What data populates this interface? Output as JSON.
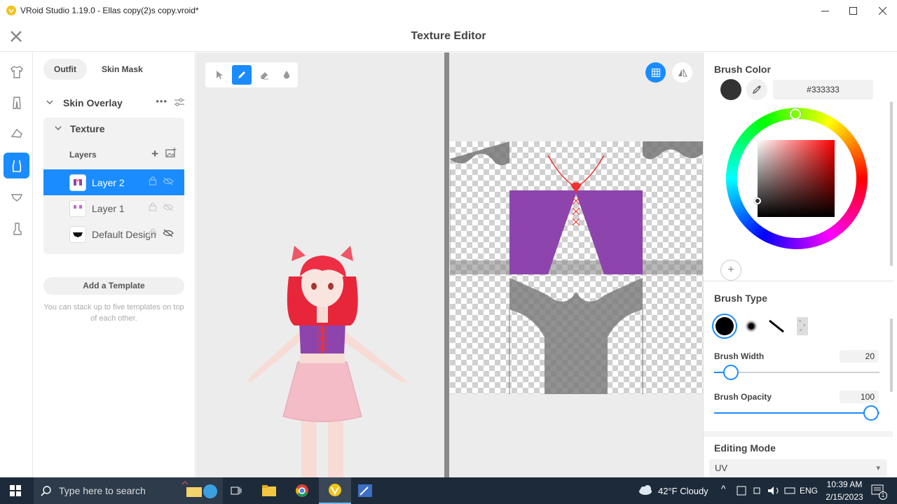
{
  "titlebar": {
    "title": "VRoid Studio 1.19.0 - Ellas copy(2)s copy.vroid*"
  },
  "header": {
    "title": "Texture Editor"
  },
  "left_panel": {
    "tabs": [
      "Outfit",
      "Skin Mask"
    ],
    "section_title": "Skin Overlay",
    "texture_title": "Texture",
    "layers_label": "Layers",
    "layers": [
      {
        "name": "Layer 2",
        "selected": true
      },
      {
        "name": "Layer 1",
        "selected": false
      },
      {
        "name": "Default Design",
        "selected": false
      }
    ],
    "add_template": "Add a Template",
    "template_hint": "You can stack up to five templates on top of each other."
  },
  "right_panel": {
    "brush_color_title": "Brush Color",
    "hex_value": "#333333",
    "brush_color": "#333333",
    "brush_type_title": "Brush Type",
    "brush_width_label": "Brush Width",
    "brush_width_value": "20",
    "brush_opacity_label": "Brush Opacity",
    "brush_opacity_value": "100",
    "editing_mode_title": "Editing Mode",
    "editing_mode_value": "UV"
  },
  "taskbar": {
    "search_placeholder": "Type here to search",
    "weather": "42°F  Cloudy",
    "lang": "ENG",
    "time": "10:39 AM",
    "date": "2/15/2023",
    "notifications": "1"
  },
  "colors": {
    "accent": "#1a8cff",
    "taskbar": "#1c2a3a",
    "garment": "#8e44ad"
  }
}
